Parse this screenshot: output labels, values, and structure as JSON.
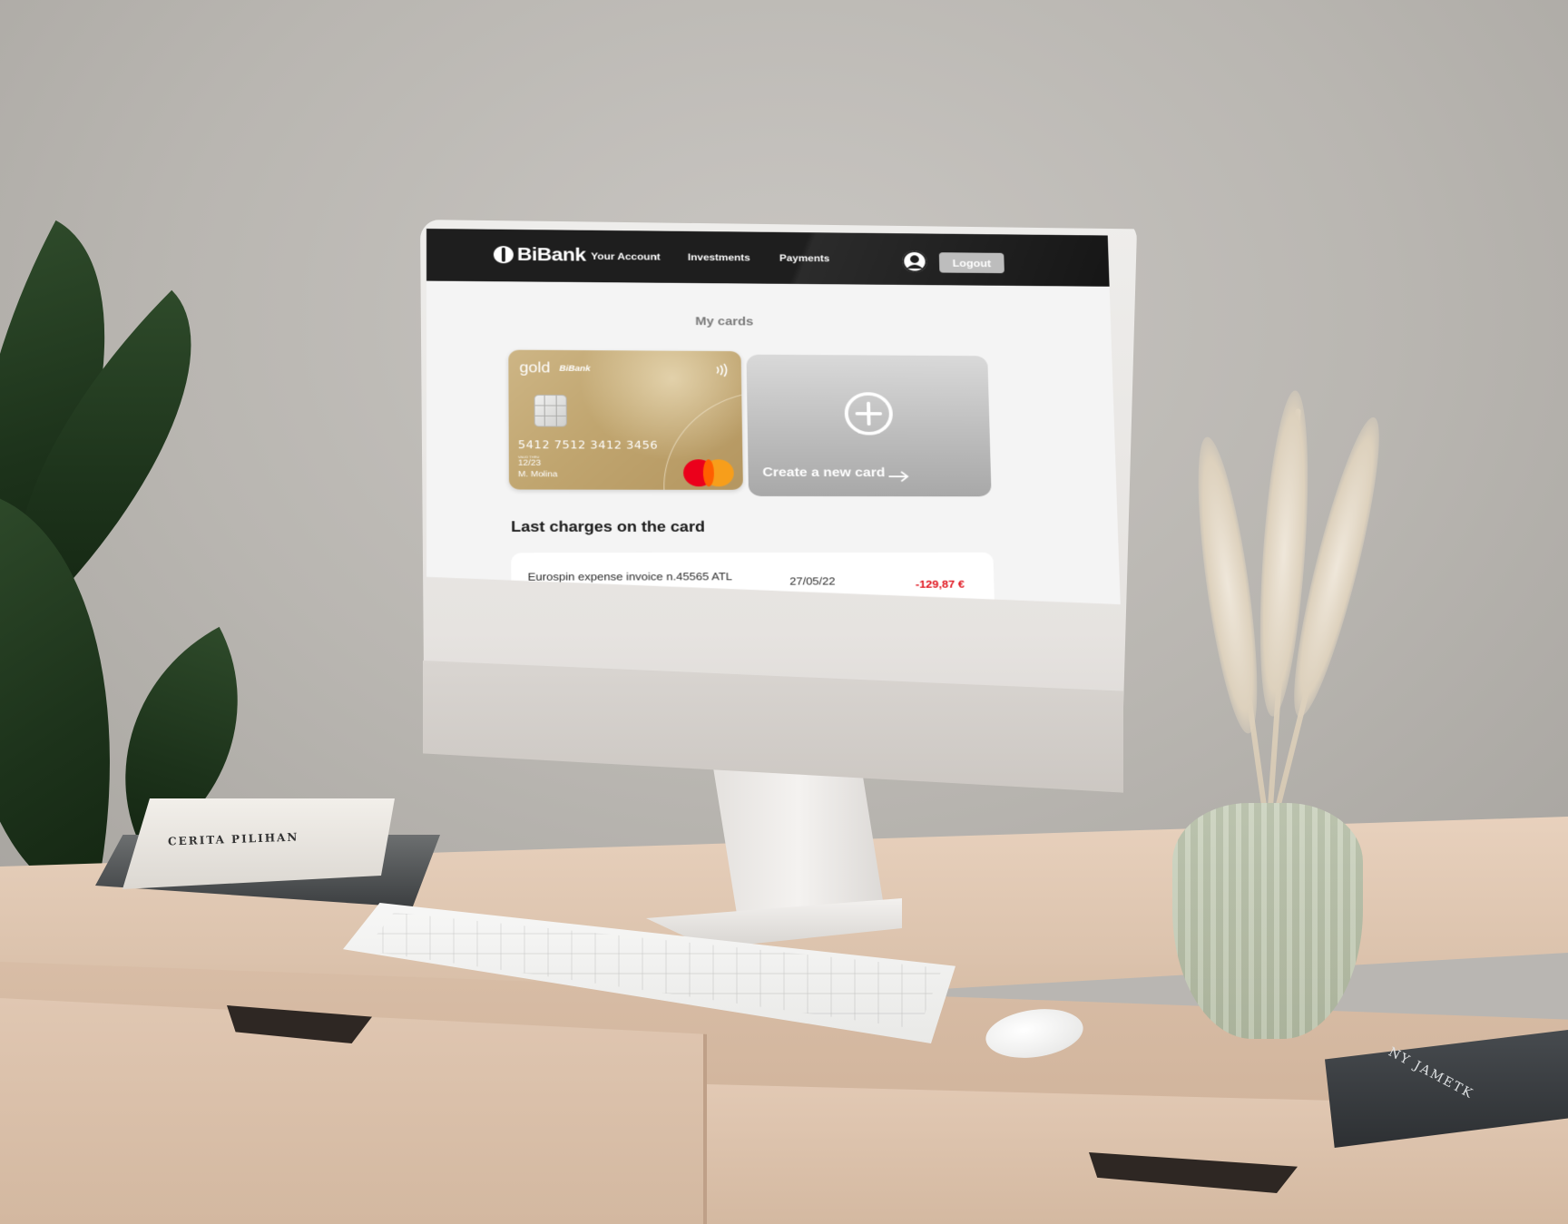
{
  "app": {
    "brand": "BiBank"
  },
  "nav": {
    "links": [
      {
        "label": "Your Account"
      },
      {
        "label": "Investments"
      },
      {
        "label": "Payments"
      }
    ],
    "logout_label": "Logout"
  },
  "main": {
    "page_title": "My cards",
    "card": {
      "tier": "gold",
      "bank": "BiBank",
      "number": "5412 7512 3412 3456",
      "valid_thru_label": "VALID THRU",
      "expiry": "12/23",
      "holder": "M. Molina",
      "network": "mastercard"
    },
    "create_card": {
      "label": "Create a new card"
    },
    "charges_title": "Last charges on the card",
    "charges": [
      {
        "description": "Eurospin expense invoice n.45565 ATL",
        "date": "27/05/22",
        "amount": "-129,87 €"
      }
    ]
  },
  "scene": {
    "book_left_title": "CERITA PILIHAN",
    "book_right_title": "NY JAMETK"
  },
  "colors": {
    "nav_bg": "#1e1e1e",
    "accent_negative": "#e0141e",
    "card_gold": "#c4a871",
    "create_card_gray": "#bdbdbd"
  }
}
